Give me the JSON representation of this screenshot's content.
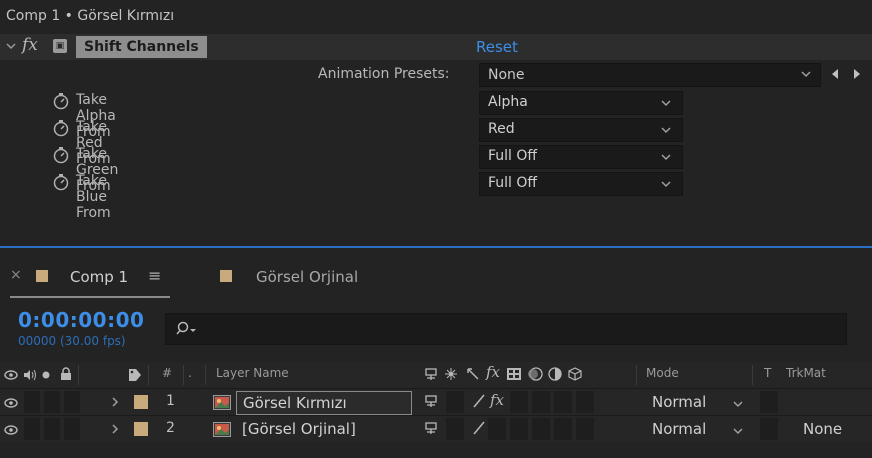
{
  "effect_panel": {
    "title": "Comp 1 • Görsel Kırmızı",
    "fx_symbol": "fx",
    "effect_name": "Shift Channels",
    "reset_label": "Reset",
    "presets_label": "Animation Presets:",
    "presets_value": "None",
    "properties": [
      {
        "label": "Take Alpha From",
        "value": "Alpha"
      },
      {
        "label": "Take Red From",
        "value": "Red"
      },
      {
        "label": "Take Green From",
        "value": "Full Off"
      },
      {
        "label": "Take Blue From",
        "value": "Full Off"
      }
    ],
    "accent_color": "#3d8ee8"
  },
  "timeline": {
    "tabs": [
      {
        "label": "Comp 1",
        "active": true,
        "menu_glyph": "≡",
        "close_glyph": "×"
      },
      {
        "label": "Görsel Orjinal",
        "active": false
      }
    ],
    "timecode": "0:00:00:00",
    "fps_label": "00000 (30.00 fps)",
    "search_placeholder": "",
    "headers": {
      "hash": "#",
      "layer_name": "Layer Name",
      "mode": "Mode",
      "t": "T",
      "trkmat": "TrkMat"
    },
    "layers": [
      {
        "num": "1",
        "name": "Görsel Kırmızı",
        "mode": "Normal",
        "trkmat": "",
        "selected_name": true,
        "has_fx": true
      },
      {
        "num": "2",
        "name": "[Görsel Orjinal]",
        "mode": "Normal",
        "trkmat": "None",
        "selected_name": false,
        "has_fx": false
      }
    ],
    "label_color": "#c8aa7c"
  }
}
